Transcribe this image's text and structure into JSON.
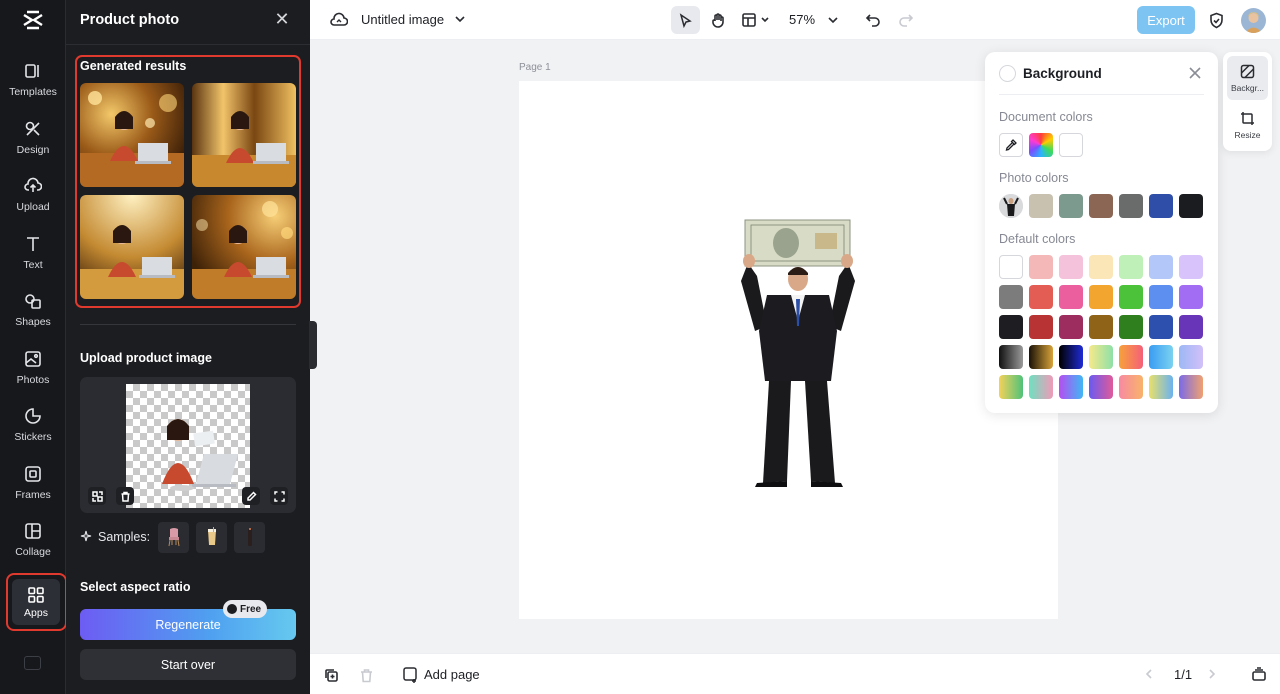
{
  "rail": {
    "items": [
      {
        "label": "Templates",
        "icon": "templates-icon"
      },
      {
        "label": "Design",
        "icon": "design-icon"
      },
      {
        "label": "Upload",
        "icon": "upload-icon"
      },
      {
        "label": "Text",
        "icon": "text-icon"
      },
      {
        "label": "Shapes",
        "icon": "shapes-icon"
      },
      {
        "label": "Photos",
        "icon": "photos-icon"
      },
      {
        "label": "Stickers",
        "icon": "stickers-icon"
      },
      {
        "label": "Frames",
        "icon": "frames-icon"
      },
      {
        "label": "Collage",
        "icon": "collage-icon"
      }
    ],
    "apps_label": "Apps"
  },
  "panel": {
    "title": "Product photo",
    "generated_label": "Generated results",
    "upload_label": "Upload product image",
    "samples_label": "Samples:",
    "aspect_label": "Select aspect ratio",
    "regenerate_label": "Regenerate",
    "free_badge": "Free",
    "start_over_label": "Start over"
  },
  "topbar": {
    "doc_title": "Untitled image",
    "zoom": "57%",
    "export_label": "Export"
  },
  "canvas": {
    "page_label": "Page 1"
  },
  "background_panel": {
    "title": "Background",
    "document_colors_label": "Document colors",
    "photo_colors_label": "Photo colors",
    "default_colors_label": "Default colors",
    "document_colors": [
      "#ffffff"
    ],
    "photo_colors": [
      "#c9c1b0",
      "#7c9a8e",
      "#8c6655",
      "#6a6b6b",
      "#2f4ea8",
      "#1a1c20"
    ],
    "default_colors": [
      [
        "#ffffff",
        "#f4b8b8",
        "#f5c2dc",
        "#fbe6b8",
        "#bff0b8",
        "#b3c8f8",
        "#d8c4fb"
      ],
      [
        "#7c7c7c",
        "#e35d55",
        "#eb5f9e",
        "#f2a630",
        "#4cc23a",
        "#5d8ff0",
        "#a26cf3"
      ],
      [
        "#1d1d22",
        "#b83333",
        "#9c2d5e",
        "#8f6318",
        "#2f7f1e",
        "#2d4fae",
        "#6935b8"
      ]
    ]
  },
  "mini_rail": {
    "background_label": "Backgr...",
    "resize_label": "Resize"
  },
  "bottombar": {
    "add_page_label": "Add page",
    "page_count": "1/1"
  },
  "colors": {
    "accent_red": "#e03a2e",
    "export_blue": "#7ec4f2",
    "panel_dark": "#1c1d21"
  }
}
